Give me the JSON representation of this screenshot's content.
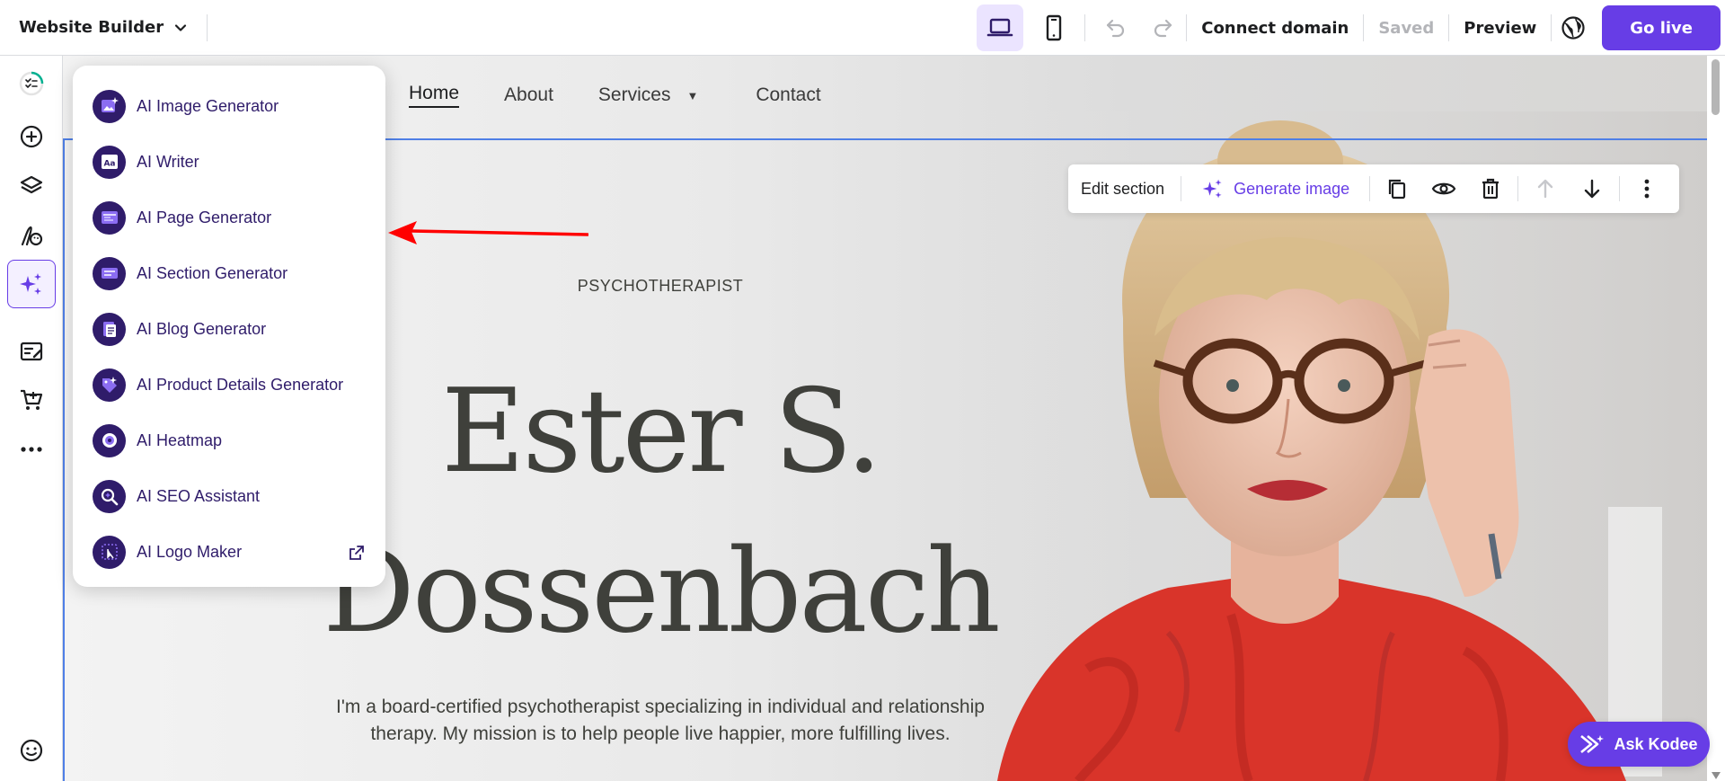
{
  "topbar": {
    "brand": "Website Builder",
    "connect_domain": "Connect domain",
    "saved": "Saved",
    "preview": "Preview",
    "go_live": "Go live"
  },
  "sidebar": {
    "items": [
      {
        "name": "checklist",
        "icon": "checklist-progress-icon"
      },
      {
        "name": "add-section",
        "icon": "plus-circle-icon"
      },
      {
        "name": "layers",
        "icon": "layers-icon"
      },
      {
        "name": "styles",
        "icon": "palette-icon"
      },
      {
        "name": "ai-tools",
        "icon": "sparkles-icon",
        "active": true
      },
      {
        "name": "blog",
        "icon": "edit-list-icon"
      },
      {
        "name": "store",
        "icon": "cart-icon"
      },
      {
        "name": "more",
        "icon": "more-horizontal-icon"
      }
    ]
  },
  "ai_menu": {
    "items": [
      {
        "label": "AI Image Generator",
        "icon": "ai-image-icon"
      },
      {
        "label": "AI Writer",
        "icon": "ai-writer-icon"
      },
      {
        "label": "AI Page Generator",
        "icon": "ai-page-icon"
      },
      {
        "label": "AI Section Generator",
        "icon": "ai-section-icon"
      },
      {
        "label": "AI Blog Generator",
        "icon": "ai-blog-icon"
      },
      {
        "label": "AI Product Details Generator",
        "icon": "ai-product-icon"
      },
      {
        "label": "AI Heatmap",
        "icon": "ai-heatmap-icon"
      },
      {
        "label": "AI SEO Assistant",
        "icon": "ai-seo-icon"
      },
      {
        "label": "AI Logo Maker",
        "icon": "ai-logo-icon",
        "external": true
      }
    ]
  },
  "site": {
    "nav": [
      "Home",
      "About",
      "Services",
      "Contact"
    ],
    "eyebrow": "PSYCHOTHERAPIST",
    "title_line1": "Ester S.",
    "title_line2": "Dossenbach",
    "desc_line1": "I'm a board-certified psychotherapist specializing in individual and relationship",
    "desc_line2": "therapy. My mission is to help people live happier, more fulfilling lives."
  },
  "section_toolbar": {
    "edit": "Edit section",
    "generate": "Generate image"
  },
  "kodee": "Ask Kodee",
  "colors": {
    "accent": "#673de6",
    "ai_icon_bg": "#2f1c6a",
    "selection": "#4f7fe6",
    "annotation": "#ff0000"
  }
}
